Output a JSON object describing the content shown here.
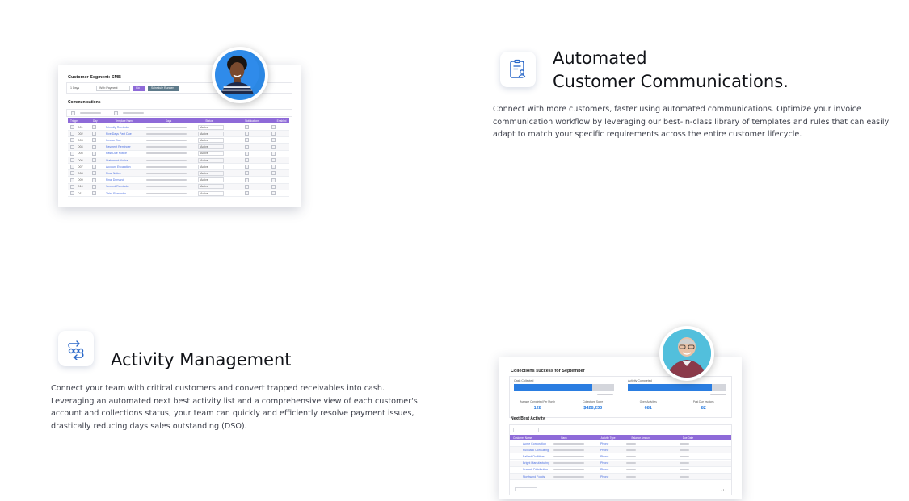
{
  "sections": {
    "communications": {
      "title_line1": "Automated",
      "title_line2": "Customer Communications.",
      "description_line1": "Connect with more customers, faster using automated communications. Optimize your invoice",
      "description_line2": "communication workflow by leveraging our best-in-class library of templates and rules that can easily",
      "description_line3": "adapt to match your specific requirements across the entire customer lifecycle.",
      "icon": "clipboard-user-icon"
    },
    "activity": {
      "title": "Activity Management",
      "description_line1": "Connect your team with critical customers and convert trapped receivables into cash.",
      "description_line2": "Leveraging an automated next best activity list and a comprehensive view of each customer's",
      "description_line3": "account and collections status, your team can quickly and efficiently resolve payment issues,",
      "description_line4": "drastically reducing days sales outstanding (DSO).",
      "icon": "workflow-arrows-icon"
    }
  },
  "mock_communications": {
    "title": "Customer Segment: SMB",
    "filter_label": "1 Days",
    "filter_value": "Web Payment",
    "btn_primary": "Go",
    "btn_secondary": "Schedule Runner",
    "section_label": "Communications",
    "columns": [
      "Trigger",
      "Day",
      "Template Name",
      "Days",
      "Status",
      "Notifications",
      "Enabled"
    ],
    "rows": [
      {
        "day": "D01",
        "name": "Friendly Reminder",
        "status": "Active"
      },
      {
        "day": "D02",
        "name": "Five Days Past Due",
        "status": "Active"
      },
      {
        "day": "D03",
        "name": "Invoice Due",
        "status": "Active"
      },
      {
        "day": "D04",
        "name": "Payment Reminder",
        "status": "Active"
      },
      {
        "day": "D05",
        "name": "Past Due Notice",
        "status": "Active"
      },
      {
        "day": "D06",
        "name": "Statement Notice",
        "status": "Active"
      },
      {
        "day": "D07",
        "name": "Account Escalation",
        "status": "Active"
      },
      {
        "day": "D08",
        "name": "Final Notice",
        "status": "Active"
      },
      {
        "day": "D09",
        "name": "Final Demand",
        "status": "Active"
      },
      {
        "day": "D10",
        "name": "Second Reminder",
        "status": "Active"
      },
      {
        "day": "D11",
        "name": "Third Reminder",
        "status": "Active"
      }
    ],
    "colors": {
      "accent": "#8e6ad8",
      "secondary_btn": "#5e7a8a"
    }
  },
  "mock_activity": {
    "title": "Collections success for September",
    "card1_label": "Cash Collected",
    "card1_progress": 0.78,
    "card2_label": "Activity Completed",
    "card2_progress": 0.85,
    "stats": [
      {
        "label": "Average Completed Per Month",
        "value": "128"
      },
      {
        "label": "Collections Score",
        "value": "$428,233"
      },
      {
        "label": "Open Activities",
        "value": "681"
      },
      {
        "label": "Past Due Invoices",
        "value": "82"
      }
    ],
    "section_label": "Next Best Activity",
    "columns": [
      "Customer Name",
      "Rank",
      "Activity Type",
      "Balance Amount",
      "Due Date"
    ],
    "rows": [
      {
        "customer": "Acme Corporation",
        "type": "Phone"
      },
      {
        "customer": "Fullstack Consulting",
        "type": "Phone"
      },
      {
        "customer": "Ballard Outfitters",
        "type": "Phone"
      },
      {
        "customer": "Bright Manufacturing",
        "type": "Phone"
      },
      {
        "customer": "Summit Distribution",
        "type": "Phone"
      },
      {
        "customer": "Northwind Foods",
        "type": "Phone"
      }
    ],
    "pagination": "1",
    "colors": {
      "accent": "#8e6ad8",
      "progress": "#2a7de1"
    }
  }
}
